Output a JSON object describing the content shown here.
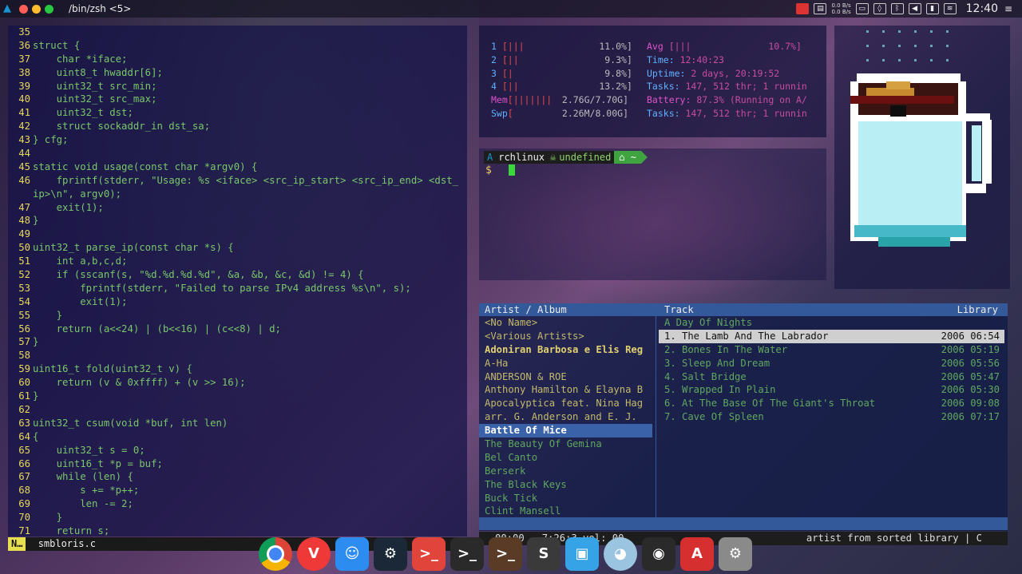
{
  "topbar": {
    "window_title": "/bin/zsh <5>",
    "net_up": "0.0 B/s",
    "net_down": "0.0 B/s",
    "clock": "12:40"
  },
  "editor": {
    "lines": [
      {
        "n": "35",
        "t": ""
      },
      {
        "n": "36",
        "t": "struct {"
      },
      {
        "n": "37",
        "t": "    char *iface;"
      },
      {
        "n": "38",
        "t": "    uint8_t hwaddr[6];"
      },
      {
        "n": "39",
        "t": "    uint32_t src_min;"
      },
      {
        "n": "40",
        "t": "    uint32_t src_max;"
      },
      {
        "n": "41",
        "t": "    uint32_t dst;"
      },
      {
        "n": "42",
        "t": "    struct sockaddr_in dst_sa;"
      },
      {
        "n": "43",
        "t": "} cfg;"
      },
      {
        "n": "44",
        "t": ""
      },
      {
        "n": "45",
        "t": "static void usage(const char *argv0) {"
      },
      {
        "n": "46",
        "t": "    fprintf(stderr, \"Usage: %s <iface> <src_ip_start> <src_ip_end> <dst_"
      },
      {
        "n": "",
        "t": "ip>\\n\", argv0);"
      },
      {
        "n": "47",
        "t": "    exit(1);"
      },
      {
        "n": "48",
        "t": "}"
      },
      {
        "n": "49",
        "t": ""
      },
      {
        "n": "50",
        "t": "uint32_t parse_ip(const char *s) {"
      },
      {
        "n": "51",
        "t": "    int a,b,c,d;"
      },
      {
        "n": "52",
        "t": "    if (sscanf(s, \"%d.%d.%d.%d\", &a, &b, &c, &d) != 4) {"
      },
      {
        "n": "53",
        "t": "        fprintf(stderr, \"Failed to parse IPv4 address %s\\n\", s);"
      },
      {
        "n": "54",
        "t": "        exit(1);"
      },
      {
        "n": "55",
        "t": "    }"
      },
      {
        "n": "56",
        "t": "    return (a<<24) | (b<<16) | (c<<8) | d;"
      },
      {
        "n": "57",
        "t": "}"
      },
      {
        "n": "58",
        "t": ""
      },
      {
        "n": "59",
        "t": "uint16_t fold(uint32_t v) {"
      },
      {
        "n": "60",
        "t": "    return (v & 0xffff) + (v >> 16);"
      },
      {
        "n": "61",
        "t": "}"
      },
      {
        "n": "62",
        "t": ""
      },
      {
        "n": "63",
        "t": "uint32_t csum(void *buf, int len)"
      },
      {
        "n": "64",
        "t": "{"
      },
      {
        "n": "65",
        "t": "    uint32_t s = 0;"
      },
      {
        "n": "66",
        "t": "    uint16_t *p = buf;"
      },
      {
        "n": "67",
        "t": "    while (len) {"
      },
      {
        "n": "68",
        "t": "        s += *p++;"
      },
      {
        "n": "69",
        "t": "        len -= 2;"
      },
      {
        "n": "70",
        "t": "    }"
      },
      {
        "n": "71",
        "t": "    return s;"
      }
    ],
    "mode": "N…",
    "filename": "smbloris.c"
  },
  "htop": {
    "cpus": [
      {
        "id": "1",
        "bar": "[|||",
        "pct": "11.0%]"
      },
      {
        "id": "2",
        "bar": "[||",
        "pct": "9.3%]"
      },
      {
        "id": "3",
        "bar": "[|",
        "pct": "9.8%]"
      },
      {
        "id": "4",
        "bar": "[||",
        "pct": "13.2%]"
      }
    ],
    "mem": {
      "label": "Mem",
      "bar": "[|||||||",
      "val": "2.76G/7.70G]"
    },
    "swp": {
      "label": "Swp",
      "bar": "[",
      "val": "2.26M/8.00G]"
    },
    "right": [
      {
        "label": "Avg",
        "val": "[|||              10.7%]"
      },
      {
        "label": "Time:",
        "val": "12:40:23"
      },
      {
        "label": "Uptime:",
        "val": "2 days, 20:19:52"
      },
      {
        "label": "Tasks:",
        "val": "147, 512 thr; 1 runnin"
      },
      {
        "label": "Battery:",
        "val": "87.3% (Running on A/"
      },
      {
        "label": "Tasks:",
        "val": "147, 512 thr; 1 runnin"
      }
    ]
  },
  "shell": {
    "arch_glyph": "A",
    "host": "rchlinux",
    "git_glyph": "☠",
    "git_text": "undefined",
    "home_glyph": "⌂ ~",
    "ps2": "$"
  },
  "cmus": {
    "head_artist": "Artist / Album",
    "head_track": "Track",
    "head_library": "Library",
    "artists": [
      {
        "t": "<No Name>",
        "s": ""
      },
      {
        "t": "<Various Artists>",
        "s": ""
      },
      {
        "t": "Adoniran Barbosa e Elis Reg",
        "s": "bold"
      },
      {
        "t": "A-Ha",
        "s": ""
      },
      {
        "t": "ANDERSON & ROE",
        "s": ""
      },
      {
        "t": "Anthony Hamilton & Elayna B",
        "s": ""
      },
      {
        "t": "Apocalyptica feat. Nina Hag",
        "s": ""
      },
      {
        "t": "arr. G. Anderson and E. J.",
        "s": ""
      },
      {
        "t": "Battle Of Mice",
        "s": "sel"
      },
      {
        "t": "The Beauty Of Gemina",
        "s": "green"
      },
      {
        "t": "Bel Canto",
        "s": "green"
      },
      {
        "t": "Berserk",
        "s": "green"
      },
      {
        "t": "The Black Keys",
        "s": "green"
      },
      {
        "t": "Buck Tick",
        "s": "green"
      },
      {
        "t": "Clint Mansell",
        "s": "green"
      }
    ],
    "album": "A Day Of Nights",
    "tracks": [
      {
        "t": "1. The Lamb And The Labrador",
        "m": "2006 06:54",
        "s": "cur"
      },
      {
        "t": "2. Bones In The Water",
        "m": "2006 05:19",
        "s": ""
      },
      {
        "t": "3. Sleep And Dream",
        "m": "2006 05:56",
        "s": ""
      },
      {
        "t": "4. Salt Bridge",
        "m": "2006 05:47",
        "s": ""
      },
      {
        "t": "5. Wrapped In Plain",
        "m": "2006 05:30",
        "s": ""
      },
      {
        "t": "6. At The Base Of The Giant's Throat",
        "m": "2006 09:08",
        "s": ""
      },
      {
        "t": "7. Cave Of Spleen",
        "m": "2006 07:17",
        "s": ""
      }
    ],
    "status_left": "00:00 - 7:26:3  vol: 00",
    "status_right": "artist from sorted library | C"
  },
  "dock": [
    {
      "name": "chrome-icon",
      "label": "",
      "color": "#e8453c"
    },
    {
      "name": "vivaldi-icon",
      "label": "V",
      "color": "#ef3939"
    },
    {
      "name": "finder-icon",
      "label": "☺",
      "color": "#2d8cf0"
    },
    {
      "name": "steam-icon",
      "label": "⚙",
      "color": "#1b2838"
    },
    {
      "name": "terminal-red-icon",
      "label": ">_",
      "color": "#e0443a"
    },
    {
      "name": "terminal-dark-icon",
      "label": ">_",
      "color": "#2a2a2a"
    },
    {
      "name": "hyper-icon",
      "label": ">_",
      "color": "#5a3b25"
    },
    {
      "name": "sublime-icon",
      "label": "S",
      "color": "#3a3a3a"
    },
    {
      "name": "virtualbox-icon",
      "label": "▣",
      "color": "#36a3e6"
    },
    {
      "name": "shark-icon",
      "label": "◕",
      "color": "#9bc4e0"
    },
    {
      "name": "nvidia-icon",
      "label": "◉",
      "color": "#2a2a2a"
    },
    {
      "name": "pdf-icon",
      "label": "A",
      "color": "#d62f2f"
    },
    {
      "name": "settings-icon",
      "label": "⚙",
      "color": "#8a8a8a"
    }
  ]
}
